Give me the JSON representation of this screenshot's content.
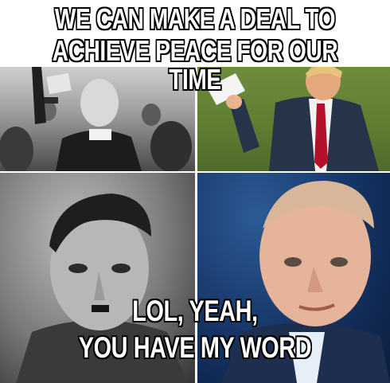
{
  "caption": {
    "top_line_1": "WE CAN MAKE A DEAL TO",
    "top_line_2": "ACHIEVE PEACE FOR OUR TIME",
    "bottom_line_1": "LOL, YEAH,",
    "bottom_line_2": "YOU HAVE MY WORD"
  },
  "colors": {
    "caption_fill": "#ffffff",
    "caption_outline": "#000000",
    "tie_red": "#b3122a",
    "suit_navy": "#263449",
    "portrait_bg_blue": "#143363"
  }
}
